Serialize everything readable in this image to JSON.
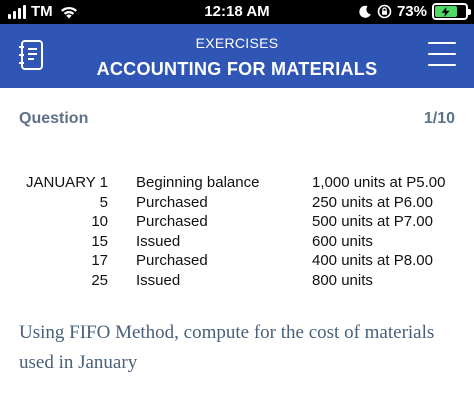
{
  "status_bar": {
    "carrier": "TM",
    "time": "12:18 AM",
    "battery_percent": "73%",
    "battery_level": 0.73,
    "icons": [
      "signal-icon",
      "wifi-icon",
      "moon-icon",
      "lock-rotation-icon",
      "battery-charging-icon"
    ]
  },
  "header": {
    "subtitle": "EXERCISES",
    "title": "ACCOUNTING FOR MATERIALS",
    "left_icon": "notebook-icon",
    "right_icon": "hamburger-menu-icon",
    "background_color": "#2f55b5"
  },
  "question": {
    "label": "Question",
    "counter": "1/10",
    "rows": [
      {
        "date": "JANUARY 1",
        "description": "Beginning balance",
        "detail": "1,000 units at P5.00"
      },
      {
        "date": "5",
        "description": "Purchased",
        "detail": "250 units at P6.00"
      },
      {
        "date": "10",
        "description": "Purchased",
        "detail": "500 units at P7.00"
      },
      {
        "date": "15",
        "description": "Issued",
        "detail": "600 units"
      },
      {
        "date": "17",
        "description": "Purchased",
        "detail": "400 units at P8.00"
      },
      {
        "date": "25",
        "description": "Issued",
        "detail": "800 units"
      }
    ],
    "prompt": "Using FIFO Method, compute for the cost of materials used in January"
  }
}
